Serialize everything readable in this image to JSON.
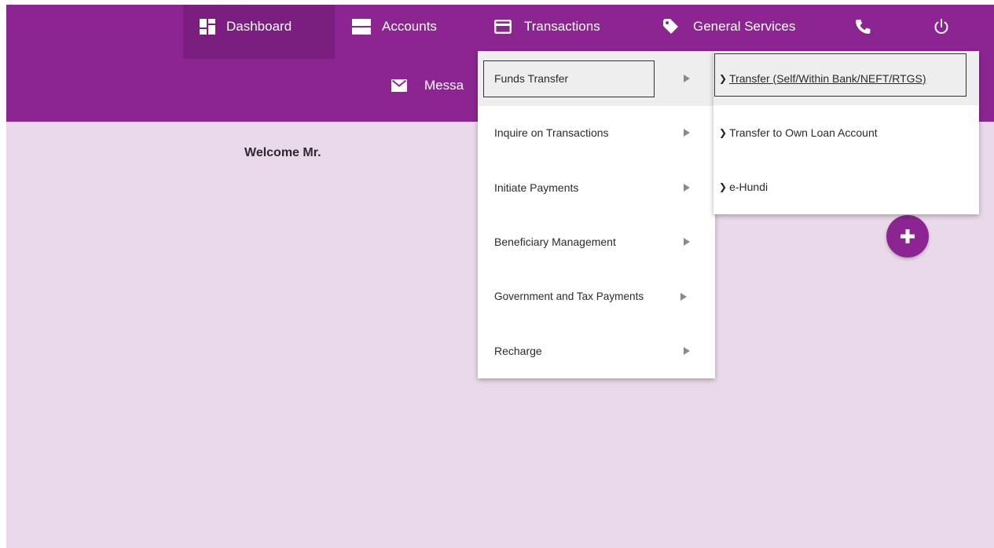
{
  "nav": {
    "dashboard": {
      "label": "Dashboard",
      "icon": "dashboard-icon"
    },
    "accounts": {
      "label": "Accounts",
      "icon": "accounts-icon"
    },
    "transactions": {
      "label": "Transactions",
      "icon": "card-icon"
    },
    "general_services": {
      "label": "General Services",
      "icon": "tag-icon"
    },
    "phone": {
      "icon": "phone-icon"
    },
    "logout": {
      "icon": "power-icon"
    },
    "messages": {
      "label": "Messa",
      "icon": "mail-icon"
    }
  },
  "main": {
    "welcome": "Welcome Mr."
  },
  "menu": {
    "items": [
      {
        "label": "Funds Transfer"
      },
      {
        "label": "Inquire on Transactions"
      },
      {
        "label": "Initiate Payments"
      },
      {
        "label": "Beneficiary Management"
      },
      {
        "label": "Government and Tax Payments"
      },
      {
        "label": "Recharge"
      }
    ]
  },
  "submenu": {
    "items": [
      {
        "label": "Transfer (Self/Within Bank/NEFT/RTGS)"
      },
      {
        "label": "Transfer to Own Loan Account"
      },
      {
        "label": "e-Hundi"
      }
    ]
  },
  "colors": {
    "brand": "#8c2591",
    "active_nav": "#7a1f80",
    "page_background": "#ead9ea"
  }
}
